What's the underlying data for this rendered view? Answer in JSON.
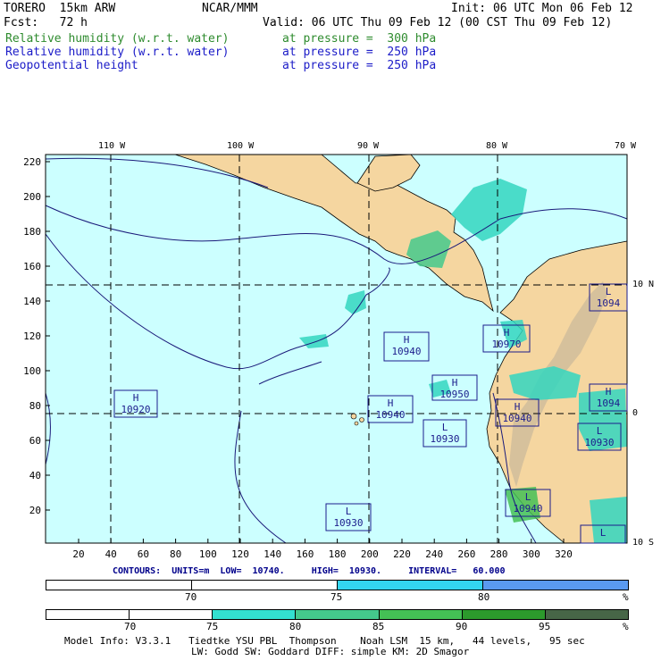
{
  "header": {
    "model": "TORERO  15km ARW",
    "center": "NCAR/MMM",
    "init": "Init: 06 UTC Mon 06 Feb 12",
    "fcst": "Fcst:   72 h",
    "valid": "Valid: 06 UTC Thu 09 Feb 12 (00 CST Thu 09 Feb 12)",
    "fields": [
      {
        "name": "Relative humidity (w.r.t. water)",
        "level": "at pressure =  300 hPa",
        "color": "#2e8b2e"
      },
      {
        "name": "Relative humidity (w.r.t. water)",
        "level": "at pressure =  250 hPa",
        "color": "#1c1cc8"
      },
      {
        "name": "Geopotential height",
        "level": "at pressure =  250 hPa",
        "color": "#1c1cc8"
      }
    ]
  },
  "map": {
    "lon_labels": [
      "110 W",
      "100 W",
      "90 W",
      "80 W",
      "70 W"
    ],
    "lat_labels": [
      "10 N",
      "0",
      "10 S"
    ],
    "y_ticks": [
      "220",
      "200",
      "180",
      "160",
      "140",
      "120",
      "100",
      "80",
      "60",
      "40",
      "20"
    ],
    "x_ticks": [
      "20",
      "40",
      "60",
      "80",
      "100",
      "120",
      "140",
      "160",
      "180",
      "200",
      "220",
      "240",
      "260",
      "280",
      "300",
      "320"
    ],
    "ocean_color": "#ccffff",
    "land_color": "#f5d6a0",
    "pressure_centers": [
      {
        "type": "H",
        "value": "10920"
      },
      {
        "type": "H",
        "value": "10940"
      },
      {
        "type": "H",
        "value": "10940"
      },
      {
        "type": "H",
        "value": "10950"
      },
      {
        "type": "H",
        "value": "10970"
      },
      {
        "type": "H",
        "value": "10940"
      },
      {
        "type": "H",
        "value": "1094"
      },
      {
        "type": "L",
        "value": "10930"
      },
      {
        "type": "L",
        "value": "10930"
      },
      {
        "type": "L",
        "value": "10930"
      },
      {
        "type": "L",
        "value": "10940"
      },
      {
        "type": "L",
        "value": "1094"
      },
      {
        "type": "L",
        "value": ""
      }
    ]
  },
  "contours": {
    "text": "CONTOURS:  UNITS=m  LOW=  10740.     HIGH=  10930.     INTERVAL=   60.000"
  },
  "colorbar1": {
    "segments": [
      {
        "color": "#ffffff"
      },
      {
        "color": "#ffffff"
      },
      {
        "color": "#33d6f0"
      },
      {
        "color": "#5a9af0"
      }
    ],
    "labels": [
      "70",
      "75",
      "80",
      "%"
    ]
  },
  "colorbar2": {
    "segments": [
      {
        "color": "#ffffff"
      },
      {
        "color": "#ffffff"
      },
      {
        "color": "#33e0d0"
      },
      {
        "color": "#44c98c"
      },
      {
        "color": "#44c055"
      },
      {
        "color": "#2c9a2c"
      },
      {
        "color": "#476647"
      }
    ],
    "labels": [
      "70",
      "75",
      "80",
      "85",
      "90",
      "95",
      "%"
    ]
  },
  "footer": {
    "line1": "Model Info: V3.3.1   Tiedtke YSU PBL  Thompson    Noah LSM  15 km,   44 levels,   95 sec",
    "line2": "LW: Godd SW: Goddard DIFF: simple KM: 2D Smagor"
  }
}
